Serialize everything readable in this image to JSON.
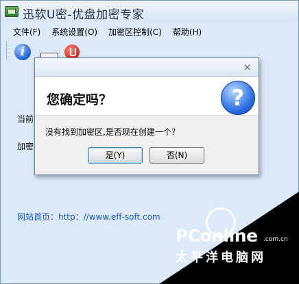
{
  "window": {
    "title": "迅软U密-优盘加密专家"
  },
  "menu": [
    {
      "label": "文件(F)"
    },
    {
      "label": "系统设置(O)"
    },
    {
      "label": "加密区控制(C)"
    },
    {
      "label": "帮助(H)"
    }
  ],
  "toolbar": {
    "icons": [
      "info-icon",
      "document-icon",
      "power-icon"
    ]
  },
  "body": {
    "label_current": "当前",
    "label_encrypt": "加密",
    "website": "网站首页：http：//www.eff-soft.com"
  },
  "dialog": {
    "close": "×",
    "heading": "您确定吗？",
    "message": "没有找到加密区,是否现在创建一个？",
    "yes_label": "是(Y)",
    "no_label": "否(N)",
    "icon": "question-icon"
  },
  "watermark": {
    "logo": "PConline",
    "domain": ".com.cn",
    "chinese": "太平洋电脑网"
  }
}
